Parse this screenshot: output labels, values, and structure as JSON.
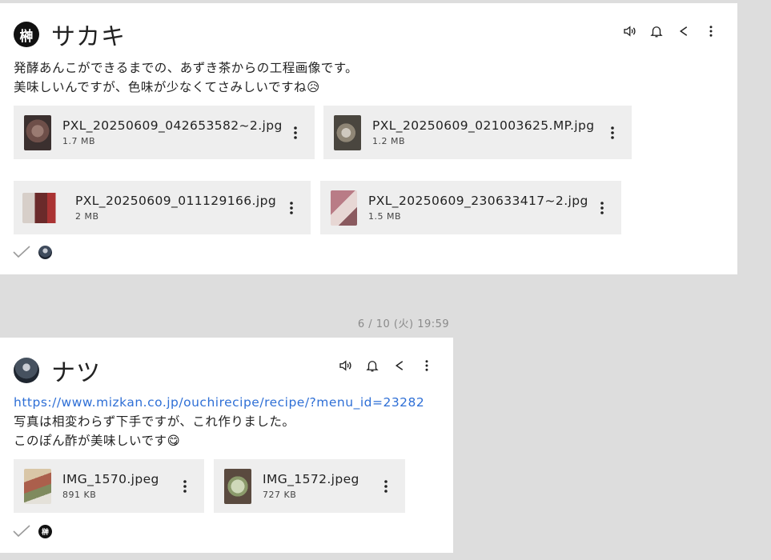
{
  "messages": [
    {
      "sender": {
        "name": "サカキ",
        "avatar_text": "榊"
      },
      "actions": [
        "speaker-icon",
        "bell-icon",
        "share-icon",
        "more-vertical-icon"
      ],
      "lines": [
        "発酵あんこができるまでの、あずき茶からの工程画像です。",
        "美味しいんですが、色味が少なくてさみしいですね😥"
      ],
      "attachments": [
        {
          "name": "PXL_20250609_042653582~2.jpg",
          "size": "1.7 MB"
        },
        {
          "name": "PXL_20250609_021003625.MP.jpg",
          "size": "1.2 MB"
        },
        {
          "name": "PXL_20250609_011129166.jpg",
          "size": "2 MB"
        },
        {
          "name": "PXL_20250609_230633417~2.jpg",
          "size": "1.5 MB"
        }
      ]
    },
    {
      "timestamp": "6 / 10 (火) 19:59",
      "sender": {
        "name": "ナツ"
      },
      "actions": [
        "speaker-icon",
        "bell-icon",
        "share-icon",
        "more-vertical-icon"
      ],
      "link": "https://www.mizkan.co.jp/ouchirecipe/recipe/?menu_id=23282",
      "lines": [
        "写真は相変わらず下手ですが、これ作りました。",
        "このぽん酢が美味しいです😋"
      ],
      "attachments": [
        {
          "name": "IMG_1570.jpeg",
          "size": "891 KB"
        },
        {
          "name": "IMG_1572.jpeg",
          "size": "727 KB"
        }
      ],
      "read_by_text": "榊"
    }
  ],
  "colors": {
    "link": "#2e6fd6",
    "card": "#ffffff",
    "background": "#dddddd",
    "attachment": "#eeeeee"
  }
}
